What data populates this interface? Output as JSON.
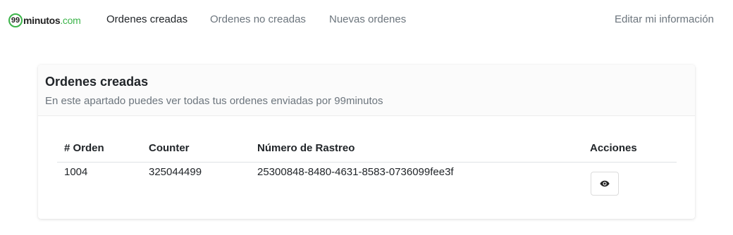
{
  "brand": {
    "logo_number": "99",
    "logo_name": "minutos",
    "logo_suffix": ".com",
    "accent_color": "#3cb44a"
  },
  "nav": {
    "items": [
      {
        "label": "Ordenes creadas",
        "active": true
      },
      {
        "label": "Ordenes no creadas",
        "active": false
      },
      {
        "label": "Nuevas ordenes",
        "active": false
      }
    ],
    "edit_profile_label": "Editar mi información"
  },
  "card": {
    "title": "Ordenes creadas",
    "subtitle": "En este apartado puedes ver todas tus ordenes enviadas por 99minutos"
  },
  "table": {
    "columns": [
      "# Orden",
      "Counter",
      "Número de Rastreo",
      "Acciones"
    ],
    "rows": [
      {
        "order": "1004",
        "counter": "325044499",
        "tracking": "25300848-8480-4631-8583-0736099fee3f",
        "action_icon": "eye-icon"
      }
    ]
  }
}
